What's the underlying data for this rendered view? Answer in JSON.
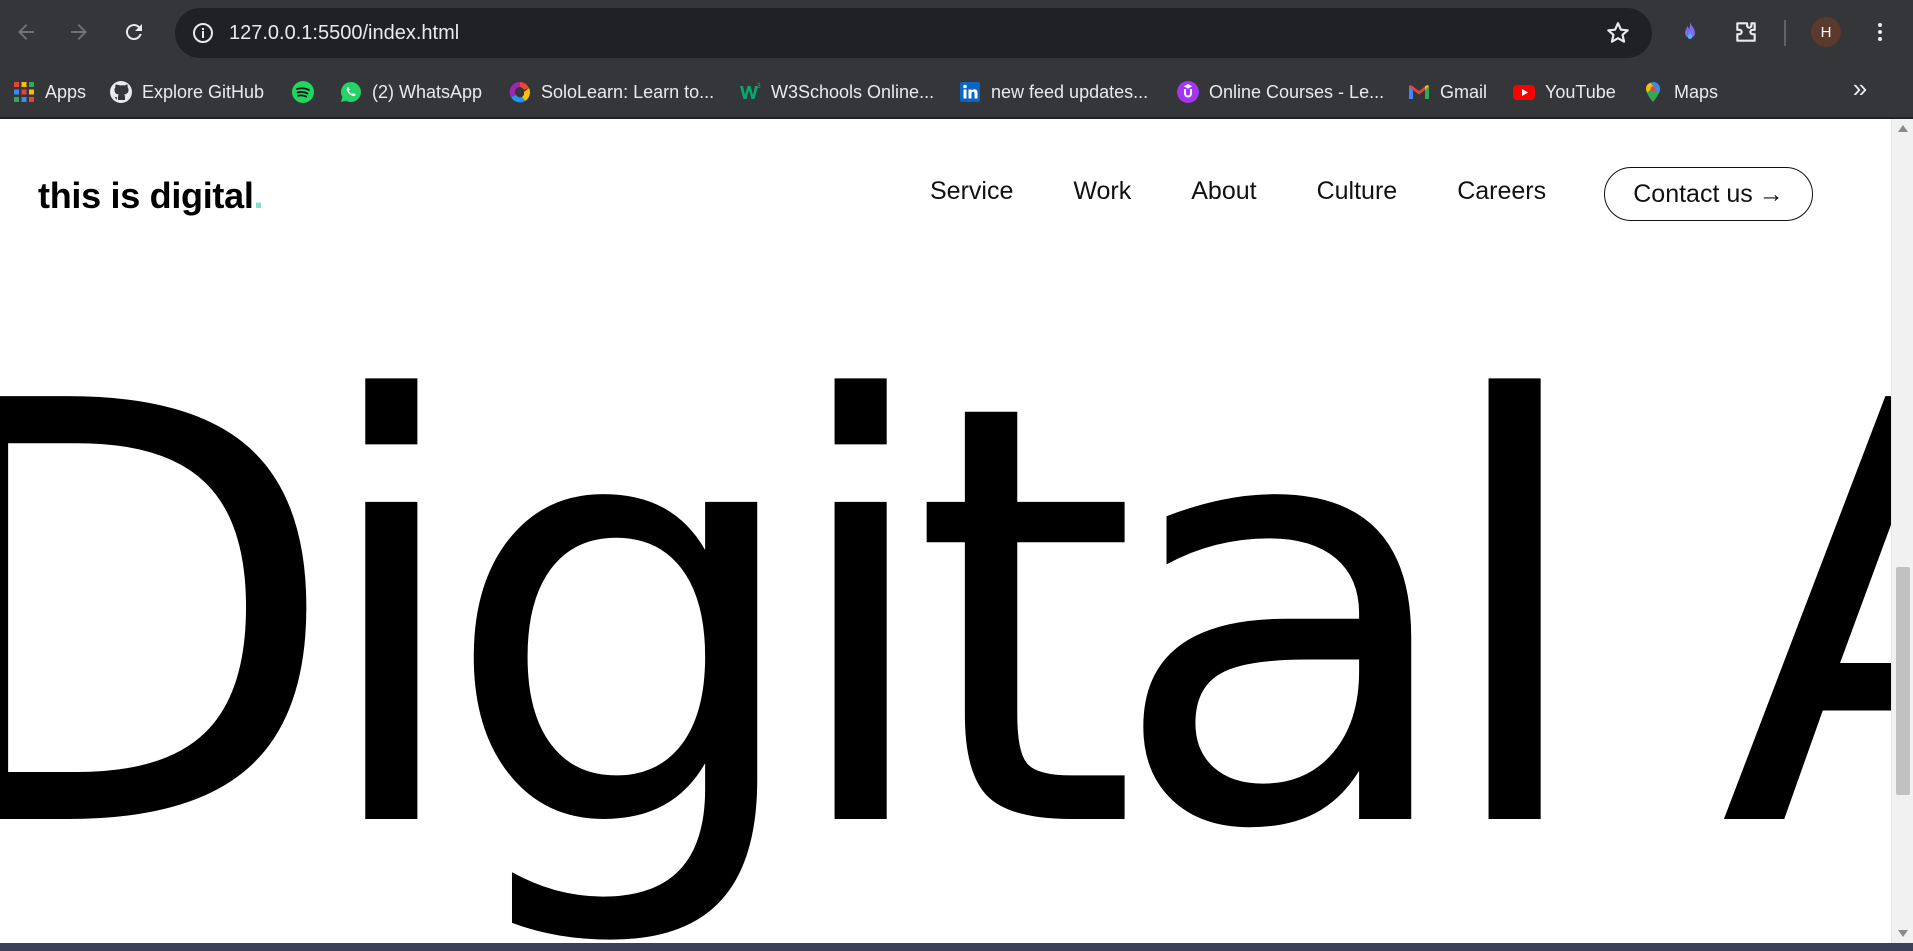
{
  "browser": {
    "url": "127.0.0.1:5500/index.html",
    "profile_initial": "H",
    "bookmarks": [
      {
        "label": "Apps",
        "icon": "apps-grid-icon"
      },
      {
        "label": "Explore GitHub",
        "icon": "github-icon"
      },
      {
        "label": "",
        "icon": "spotify-icon"
      },
      {
        "label": "(2) WhatsApp",
        "icon": "whatsapp-icon"
      },
      {
        "label": "SoloLearn: Learn to...",
        "icon": "sololearn-icon"
      },
      {
        "label": "W3Schools Online...",
        "icon": "w3schools-icon"
      },
      {
        "label": "new feed updates...",
        "icon": "linkedin-icon"
      },
      {
        "label": "Online Courses - Le...",
        "icon": "udemy-icon"
      },
      {
        "label": "Gmail",
        "icon": "gmail-icon"
      },
      {
        "label": "YouTube",
        "icon": "youtube-icon"
      },
      {
        "label": "Maps",
        "icon": "maps-icon"
      }
    ],
    "more_label": "»"
  },
  "site": {
    "logo_text": "this is digital",
    "logo_dot": ".",
    "nav": [
      "Service",
      "Work",
      "About",
      "Culture",
      "Careers"
    ],
    "contact_label": "Contact us",
    "contact_arrow": "→",
    "hero_text": "Digital A"
  },
  "colors": {
    "accent_dot": "#7ee0cf",
    "chrome_bg": "#35363a",
    "omnibox_bg": "#202124",
    "page_bg": "#ffffff",
    "text": "#000000"
  }
}
